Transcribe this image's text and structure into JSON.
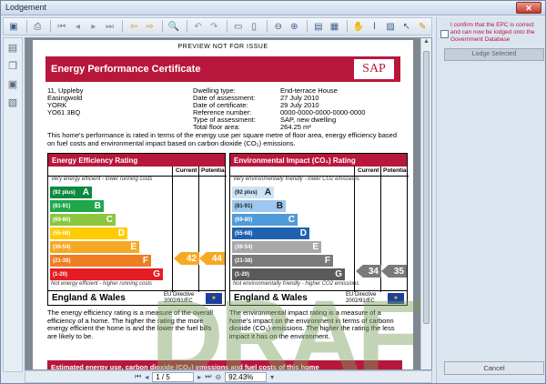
{
  "window": {
    "title": "Lodgement",
    "close_glyph": "✕"
  },
  "toolbar": {
    "icons": [
      "save-icon",
      "print-icon",
      "page-first-icon",
      "page-prev-icon",
      "page-next-icon",
      "page-last-icon",
      "back-arrow-icon",
      "forward-arrow-icon",
      "zoom-icon",
      "rotate-ccw-icon",
      "rotate-cw-icon",
      "fit-width-icon",
      "fit-page-icon",
      "zoom-out-icon",
      "zoom-in-icon",
      "single-page-icon",
      "multi-page-icon",
      "hand-tool-icon",
      "text-select-icon",
      "snapshot-icon",
      "pointer-icon",
      "annotate-icon"
    ]
  },
  "document": {
    "preview_label": "PREVIEW NOT FOR ISSUE",
    "cert_title": "Energy Performance Certificate",
    "sap_logo": "SAP",
    "address": [
      "11, Uppleby",
      "Easingwold",
      "YORK",
      "YO61 3BQ"
    ],
    "details": [
      {
        "k": "Dwelling type:",
        "v": "End-terrace House"
      },
      {
        "k": "Date of assessment:",
        "v": "27 July 2010"
      },
      {
        "k": "Date of certificate:",
        "v": "29 July 2010"
      },
      {
        "k": "Reference number:",
        "v": "0000-0000-0000-0000-0000"
      },
      {
        "k": "Type of assessment:",
        "v": "SAP, new dwelling"
      },
      {
        "k": "Total floor area:",
        "v": "264.25 m²"
      }
    ],
    "description": "This home's performance is rated in terms of the energy use per square metre of floor area, energy efficiency based on fuel costs and environmental impact based on carbon dioxide (CO₂) emissions.",
    "ee": {
      "title": "Energy Efficiency Rating",
      "top_note": "Very energy efficient - lower running costs",
      "bottom_note": "Not energy efficient - higher running costs",
      "current": "42",
      "potential": "44"
    },
    "ei": {
      "title": "Environmental Impact (CO₂) Rating",
      "top_note": "Very environmentally friendly - lower CO2 emissions",
      "bottom_note": "Not environmentally friendly - higher CO2 emissions",
      "current": "34",
      "potential": "35"
    },
    "col_current": "Current",
    "col_potential": "Potential",
    "bands": [
      {
        "range": "(92 plus)",
        "letter": "A"
      },
      {
        "range": "(81-91)",
        "letter": "B"
      },
      {
        "range": "(69-80)",
        "letter": "C"
      },
      {
        "range": "(55-68)",
        "letter": "D"
      },
      {
        "range": "(39-54)",
        "letter": "E"
      },
      {
        "range": "(21-38)",
        "letter": "F"
      },
      {
        "range": "(1-20)",
        "letter": "G"
      }
    ],
    "region": "England & Wales",
    "eu_line1": "EU Directive",
    "eu_line2": "2002/91/EC",
    "para_left": "The energy efficiency rating is a measure of the overall efficiency of a home. The higher the rating the more energy efficient the home is and the lower the fuel bills are likely to be.",
    "para_right": "The environmental impact rating is a measure of a home's impact on the environment in terms of carbonn dioxide (CO₂) emissions. The higher the rating the less impact it has on the environment.",
    "estimate_bar": "Estimated energy use, carbon dioxide (CO₂) emissions and fuel costs of this home",
    "watermark": "DRAFT"
  },
  "statusbar": {
    "page": "1 / 5",
    "zoom": "92.43%"
  },
  "sidepanel": {
    "confirm_text": "I confirm that the EPC is correct and can now be lodged onto the Government Database",
    "lodge_label": "Lodge Selected",
    "cancel_label": "Cancel"
  },
  "colors": {
    "ee": [
      "#0a8a3c",
      "#1ea84a",
      "#8cc63f",
      "#ffcc00",
      "#f7a823",
      "#ef7d22",
      "#e31d23"
    ],
    "ei": [
      "#cde3f6",
      "#9cc7ee",
      "#4f9ad8",
      "#1f63b0",
      "#a8a8a8",
      "#7a7a7a",
      "#5a5a5a"
    ],
    "accent": "#b8173c"
  }
}
